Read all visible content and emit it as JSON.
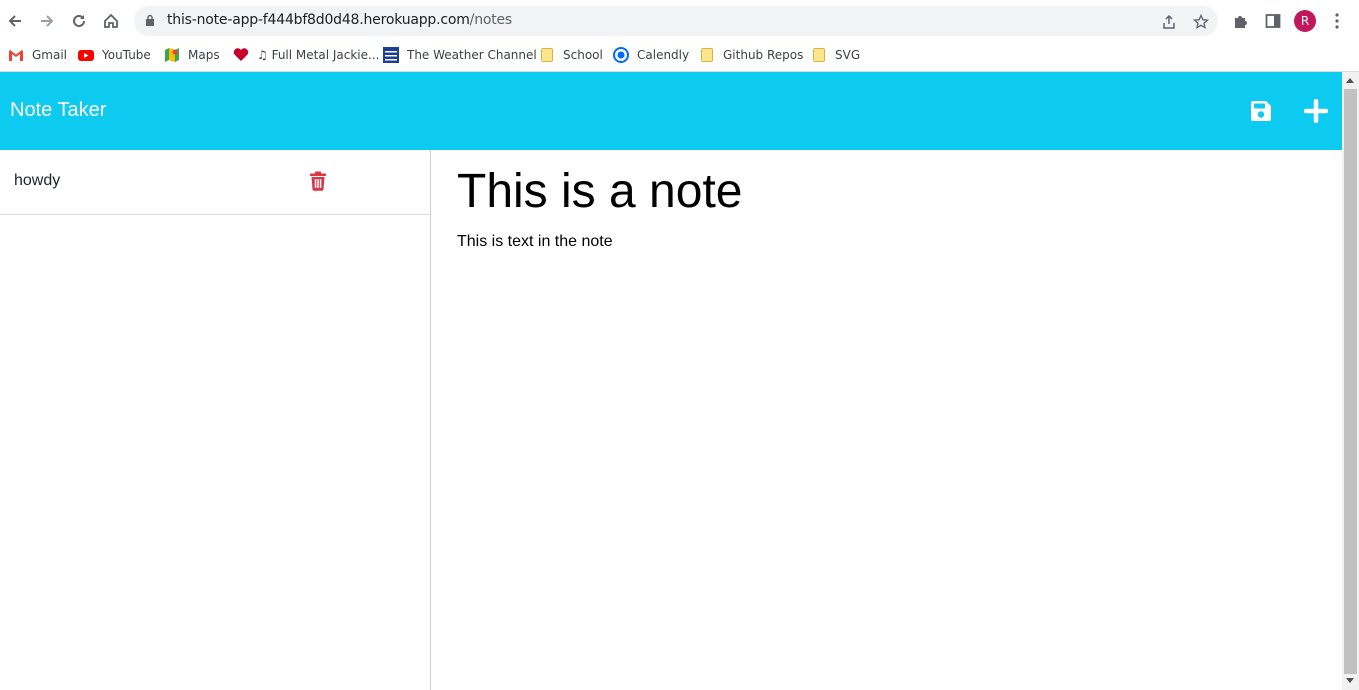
{
  "browser": {
    "url_host": "this-note-app-f444bf8d0d48.herokuapp.com",
    "url_path": "/notes",
    "profile_initial": "R",
    "bookmarks": [
      {
        "label": "Gmail",
        "icon": "gmail-icon"
      },
      {
        "label": "YouTube",
        "icon": "youtube-icon"
      },
      {
        "label": "Maps",
        "icon": "maps-icon"
      },
      {
        "label": "♫ Full Metal Jackie...",
        "icon": "iheart-icon"
      },
      {
        "label": "The Weather Channel",
        "icon": "weather-channel-icon"
      },
      {
        "label": "School",
        "icon": "folder-icon"
      },
      {
        "label": "Calendly",
        "icon": "calendly-icon"
      },
      {
        "label": "Github Repos",
        "icon": "folder-icon"
      },
      {
        "label": "SVG",
        "icon": "folder-icon"
      }
    ]
  },
  "app": {
    "title": "Note Taker",
    "header_color": "#0ccaf0",
    "actions": {
      "save": "save-icon",
      "new": "plus-icon"
    }
  },
  "notes": [
    {
      "title": "howdy",
      "delete_icon": "trash-icon",
      "delete_color": "#dc3545"
    }
  ],
  "active_note": {
    "title": "This is a note",
    "text": "This is text in the note"
  }
}
